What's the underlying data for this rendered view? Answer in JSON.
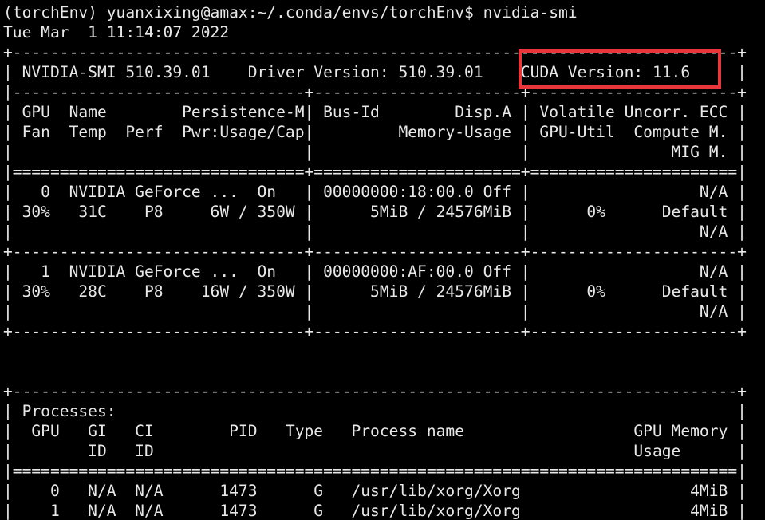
{
  "prompt": "(torchEnv) yuanxixing@amax:~/.conda/envs/torchEnv$ nvidia-smi",
  "timestamp": "Tue Mar  1 11:14:07 2022",
  "smi_table": {
    "border_top": "+-----------------------------------------------------------------------------+",
    "header_line": "| NVIDIA-SMI 510.39.01    Driver Version: 510.39.01    CUDA Version: 11.6     |",
    "header_divider": "|-------------------------------+----------------------+----------------------+",
    "column_headers": [
      "| GPU  Name        Persistence-M| Bus-Id        Disp.A | Volatile Uncorr. ECC |",
      "| Fan  Temp  Perf  Pwr:Usage/Cap|         Memory-Usage | GPU-Util  Compute M. |",
      "|                               |                      |               MIG M. |"
    ],
    "header_separator": "|===============================+======================+======================|",
    "gpus": [
      {
        "lines": [
          "|   0  NVIDIA GeForce ...  On   | 00000000:18:00.0 Off |                  N/A |",
          "| 30%   31C    P8     6W / 350W |      5MiB / 24576MiB |      0%      Default |",
          "|                               |                      |                  N/A |"
        ],
        "footer": "+-------------------------------+----------------------+----------------------+"
      },
      {
        "lines": [
          "|   1  NVIDIA GeForce ...  On   | 00000000:AF:00.0 Off |                  N/A |",
          "| 30%   28C    P8    16W / 350W |      5MiB / 24576MiB |      0%      Default |",
          "|                               |                      |                  N/A |"
        ],
        "footer": "+-------------------------------+----------------------+----------------------+"
      }
    ]
  },
  "blank": " ",
  "processes_table": {
    "border_top": "+-----------------------------------------------------------------------------+",
    "title_line": "| Processes:                                                                  |",
    "column_headers": [
      "|  GPU   GI   CI        PID   Type   Process name                  GPU Memory |",
      "|        ID   ID                                                   Usage      |"
    ],
    "header_separator": "|=============================================================================|",
    "rows": [
      "|    0   N/A  N/A      1473      G   /usr/lib/xorg/Xorg                  4MiB |",
      "|    1   N/A  N/A      1473      G   /usr/lib/xorg/Xorg                  4MiB |"
    ]
  },
  "highlight": {
    "label": "CUDA Version: 11.6",
    "color": "#e8363b"
  }
}
